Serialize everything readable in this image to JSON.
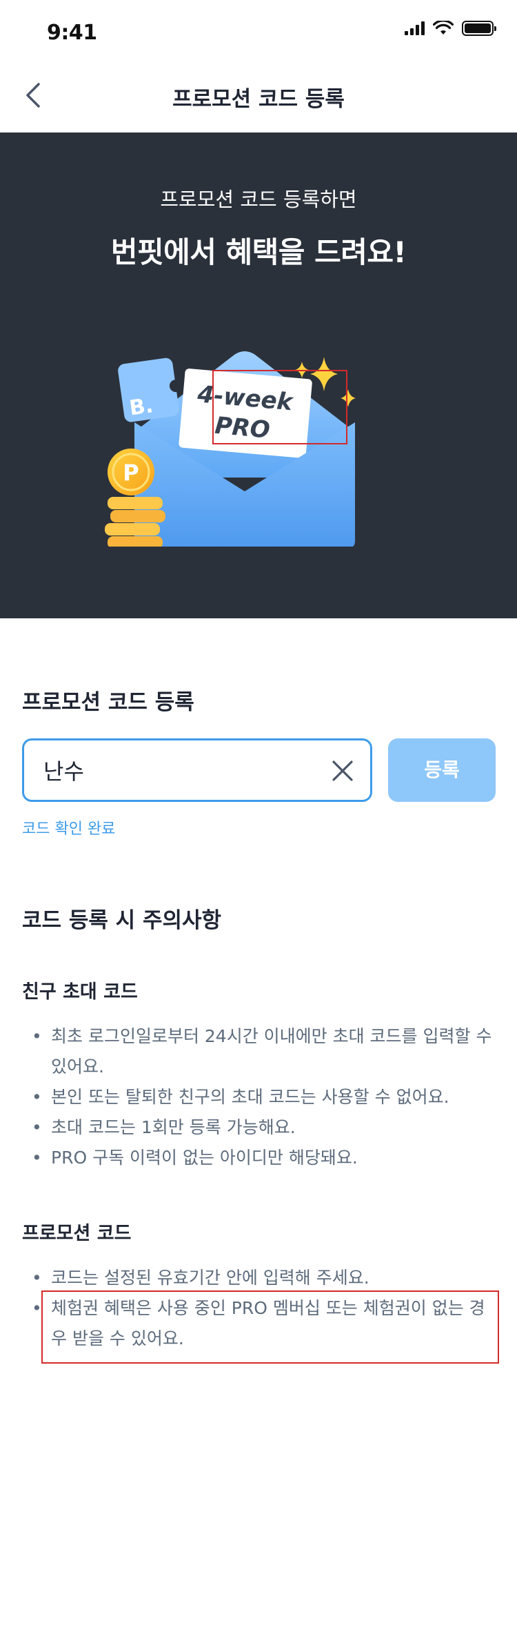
{
  "status_bar": {
    "time": "9:41"
  },
  "header": {
    "title": "프로모션 코드 등록"
  },
  "hero": {
    "subtitle": "프로모션 코드 등록하면",
    "title": "번핏에서 혜택을 드려요!",
    "card_line1": "4-week",
    "card_line2": "PRO",
    "coin_letter": "P",
    "brand_mark": "B."
  },
  "form": {
    "section_title": "프로모션 코드 등록",
    "input_value": "난수",
    "input_placeholder": "",
    "register_label": "등록",
    "status_message": "코드 확인 완료"
  },
  "notes": {
    "title": "코드 등록 시 주의사항",
    "groups": [
      {
        "title": "친구 초대 코드",
        "items": [
          "최초 로그인일로부터 24시간 이내에만 초대 코드를 입력할 수 있어요.",
          "본인 또는 탈퇴한 친구의 초대 코드는 사용할 수 없어요.",
          "초대 코드는 1회만 등록 가능해요.",
          "PRO 구독 이력이 없는 아이디만 해당돼요."
        ]
      },
      {
        "title": "프로모션 코드",
        "items": [
          "코드는 설정된 유효기간 안에 입력해 주세요.",
          "체험권 혜택은 사용 중인 PRO 멤버십 또는 체험권이 없는 경우 받을 수 있어요."
        ]
      }
    ]
  },
  "colors": {
    "accent": "#3d9be9",
    "button_disabled": "#8ec7f9",
    "hero_bg": "#2b313b",
    "highlight": "#d42a2a"
  }
}
